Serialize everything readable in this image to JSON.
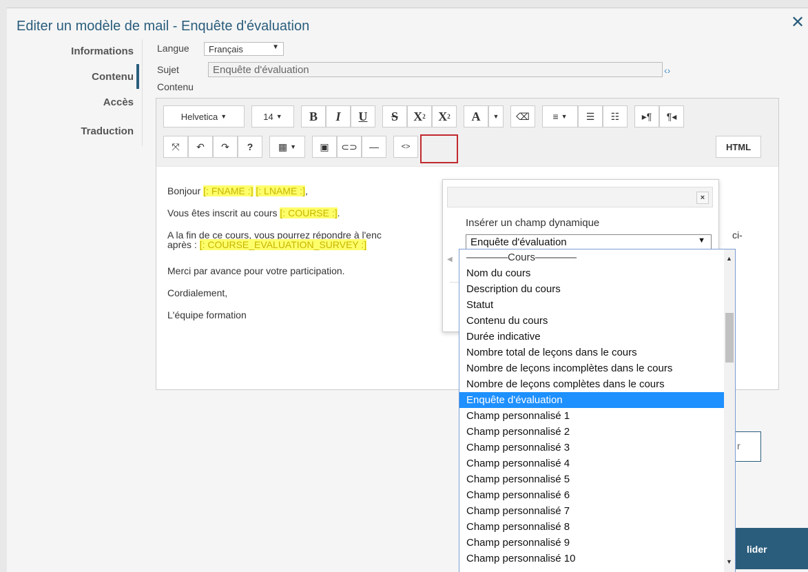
{
  "dialog": {
    "title": "Editer un modèle de mail - Enquête d'évaluation",
    "close_icon": "close-icon"
  },
  "sidebar": {
    "items": [
      {
        "label": "Informations"
      },
      {
        "label": "Contenu",
        "active": true
      },
      {
        "label": "Accès"
      },
      {
        "label": "Traduction"
      }
    ]
  },
  "form": {
    "langue_label": "Langue",
    "langue_value": "Français",
    "sujet_label": "Sujet",
    "sujet_value": "Enquête d'évaluation",
    "contenu_label": "Contenu"
  },
  "toolbar": {
    "font_family": "Helvetica",
    "font_size": "14",
    "bold": "B",
    "italic": "I",
    "underline": "U",
    "strikethrough": "S",
    "superscript": "X",
    "subscript": "X",
    "color": "A",
    "help": "?",
    "html": "HTML"
  },
  "editor": {
    "greeting": "Bonjour",
    "fname_tag": "[: FNAME :]",
    "lname_tag": "[: LNAME :]",
    "comma": ",",
    "line2_prefix": "Vous êtes inscrit au cours",
    "course_tag": "[: COURSE :]",
    "line2_suffix": ".",
    "line3_start": "A la fin de ce cours, vous pourrez répondre à l'enc",
    "line3_end": "ci-",
    "line4_prefix": "après :",
    "survey_tag": "[: COURSE_EVALUATION_SURVEY :]",
    "line5": "Merci par avance pour votre participation.",
    "line6": "Cordialement,",
    "line7": "L'équipe formation"
  },
  "popup": {
    "label": "Insérer un champ dynamique",
    "selected_value": "Enquête d'évaluation",
    "close": "×"
  },
  "dropdown": {
    "group_label": "————Cours————",
    "options": [
      "Nom du cours",
      "Description du cours",
      "Statut",
      "Contenu du cours",
      "Durée indicative",
      "Nombre total de leçons dans le cours",
      "Nombre de leçons incomplètes dans le cours",
      "Nombre de leçons complètes dans le cours",
      "Enquête d'évaluation",
      "Champ personnalisé 1",
      "Champ personnalisé 2",
      "Champ personnalisé 3",
      "Champ personnalisé 4",
      "Champ personnalisé 5",
      "Champ personnalisé 6",
      "Champ personnalisé 7",
      "Champ personnalisé 8",
      "Champ personnalisé 9",
      "Champ personnalisé 10"
    ],
    "selected_index": 8
  },
  "footer": {
    "partial_button": "r",
    "valider_partial": "lider"
  },
  "colors": {
    "accent": "#2a5d7c",
    "highlight_border": "#c0282d",
    "tag_bg": "#fefe6a",
    "selected_option": "#1e90ff"
  }
}
